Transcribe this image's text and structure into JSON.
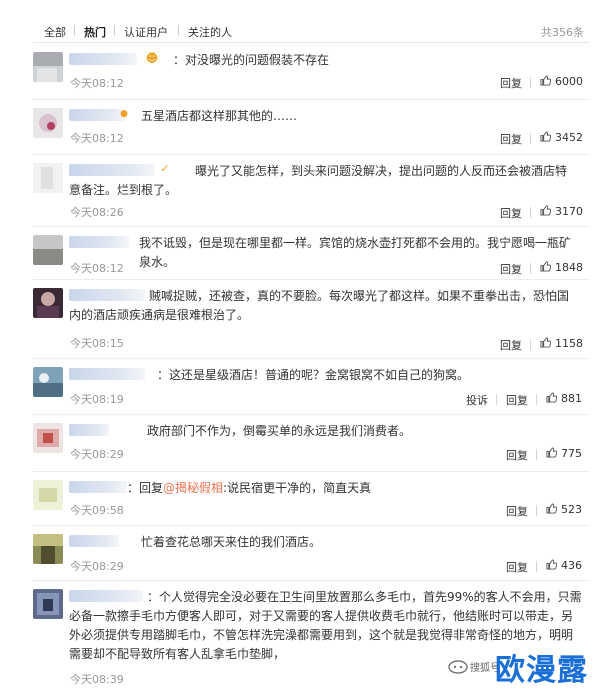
{
  "tabs": {
    "items": [
      {
        "label": "全部",
        "active": false
      },
      {
        "label": "热门",
        "active": true
      },
      {
        "label": "认证用户",
        "active": false
      },
      {
        "label": "关注的人",
        "active": false
      }
    ],
    "total": "共356条"
  },
  "icons": {
    "thumb": "thumbs-up-icon",
    "verified": "verified-badge-icon",
    "emoji": "emoji-icon"
  },
  "accent_colors": {
    "link": "#eb7350",
    "watermark": "#1a6fd6",
    "badge": "#f0a020"
  },
  "comments": [
    {
      "text": "：对没曝光的问题假装不存在",
      "time": "今天08:12",
      "reply": "回复",
      "likes": "6000"
    },
    {
      "text": "五星酒店都这样那其他的……",
      "time": "今天08:12",
      "reply": "回复",
      "likes": "3452"
    },
    {
      "text": "曝光了又能怎样，到头来问题没解决，提出问题的人反而还会被酒店特意备注。烂到根了。",
      "time": "今天08:26",
      "reply": "回复",
      "likes": "3170"
    },
    {
      "text": "我不诋毁，但是现在哪里都一样。宾馆的烧水壶打死都不会用的。我宁愿喝一瓶矿泉水。",
      "time": "今天08:12",
      "reply": "回复",
      "likes": "1848"
    },
    {
      "text": "贼喊捉贼，还被查，真的不要脸。每次曝光了都这样。如果不重拳出击，恐怕国内的酒店顽疾通病是很难根治了。",
      "time": "今天08:15",
      "reply": "回复",
      "likes": "1158"
    },
    {
      "text": "：这还是星级酒店！普通的呢？金窝银窝不如自己的狗窝。",
      "time": "今天08:19",
      "report": "投诉",
      "reply": "回复",
      "likes": "881"
    },
    {
      "text": "政府部门不作为，倒霉买单的永远是我们消费者。",
      "time": "今天08:29",
      "reply": "回复",
      "likes": "775"
    },
    {
      "prefix": "：回复",
      "mention": "@揭秘假相",
      "text": ":说民宿更干净的，简直天真",
      "time": "今天09:58",
      "reply": "回复",
      "likes": "523"
    },
    {
      "text": "忙着查花总哪天来住的我们酒店。",
      "time": "今天08:29",
      "reply": "回复",
      "likes": "436"
    },
    {
      "text": "：个人觉得完全没必要在卫生间里放置那么多毛巾，首先99%的客人不会用，只需必备一款擦手毛巾方便客人即可，对于又需要的客人提供收费毛巾就行，他结账时可以带走，另外必须提供专用踏脚毛巾，不管怎样洗完澡都需要用到，这个就是我觉得非常奇怪的地方，明明需要却不配导致所有客人乱拿毛巾垫脚，",
      "time": "今天08:39"
    }
  ],
  "watermark": {
    "small": "搜狐号",
    "big": "欧漫露"
  }
}
